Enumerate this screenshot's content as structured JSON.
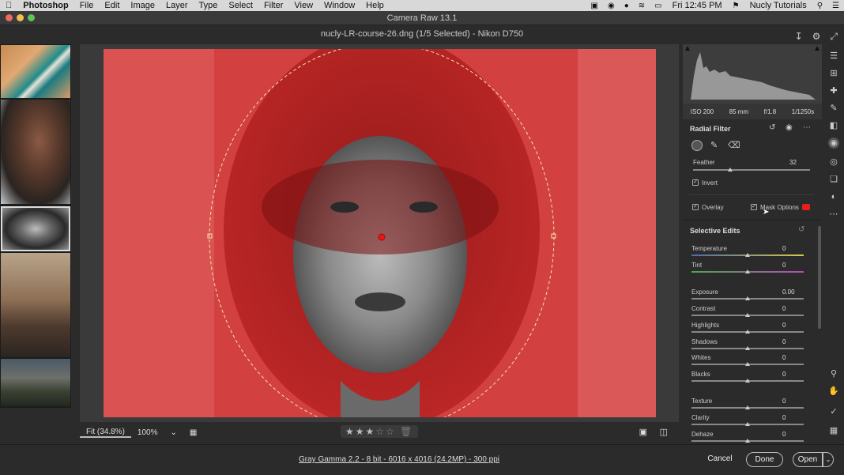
{
  "menubar": {
    "app": "Photoshop",
    "items": [
      "File",
      "Edit",
      "Image",
      "Layer",
      "Type",
      "Select",
      "Filter",
      "View",
      "Window",
      "Help"
    ],
    "clock": "Fri 12:45 PM",
    "user": "Nucly Tutorials"
  },
  "window_title": "Camera Raw 13.1",
  "file_header": "nucly-LR-course-26.dng (1/5 Selected)  -  Nikon D750",
  "exif": {
    "iso": "ISO 200",
    "focal": "85 mm",
    "aperture": "f/1.8",
    "shutter": "1/1250s"
  },
  "panel": {
    "title": "Radial Filter",
    "feather_label": "Feather",
    "feather_value": "32",
    "feather_fraction": 0.32,
    "invert_label": "Invert",
    "overlay_label": "Overlay",
    "mask_options_label": "Mask Options",
    "mask_color": "#e61e1e",
    "selective_edits_title": "Selective Edits",
    "sliders": [
      {
        "label": "Temperature",
        "value": "0"
      },
      {
        "label": "Tint",
        "value": "0"
      },
      {
        "label": "Exposure",
        "value": "0.00"
      },
      {
        "label": "Contrast",
        "value": "0"
      },
      {
        "label": "Highlights",
        "value": "0"
      },
      {
        "label": "Shadows",
        "value": "0"
      },
      {
        "label": "Whites",
        "value": "0"
      },
      {
        "label": "Blacks",
        "value": "0"
      },
      {
        "label": "Texture",
        "value": "0"
      },
      {
        "label": "Clarity",
        "value": "0"
      },
      {
        "label": "Dehaze",
        "value": "0"
      }
    ]
  },
  "bottom": {
    "fit_label": "Fit (34.8%)",
    "zoom_label": "100%",
    "rating_stars": 3,
    "rating_max": 5
  },
  "footer": {
    "info": "Gray Gamma 2.2 - 8 bit - 6016 x 4016 (24.2MP) - 300 ppi",
    "cancel": "Cancel",
    "done": "Done",
    "open": "Open"
  },
  "colors": {
    "overlay_red": "#d63a3a",
    "background": "#2b2b2b"
  }
}
